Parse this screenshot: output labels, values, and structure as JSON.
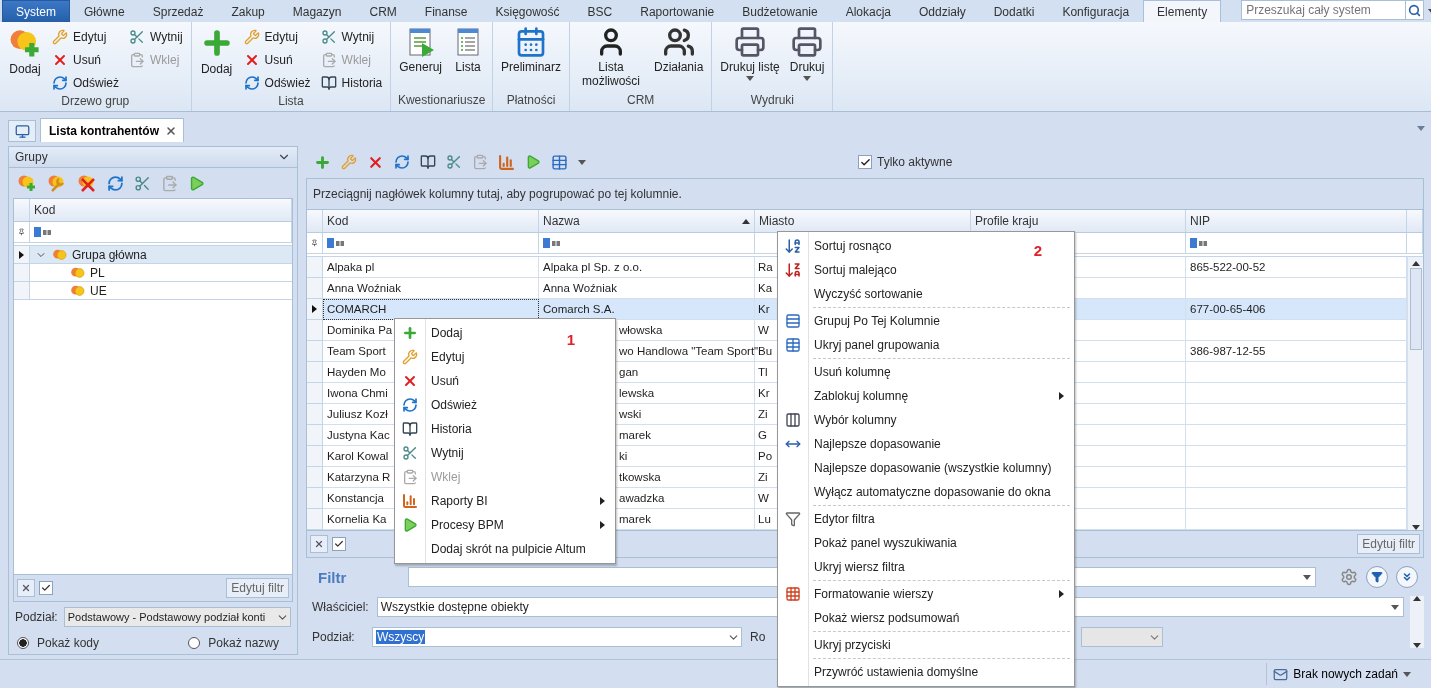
{
  "tabs": [
    {
      "label": "System",
      "selected": false,
      "kind": "application"
    },
    {
      "label": "Główne",
      "selected": false,
      "kind": "ribbon"
    },
    {
      "label": "Sprzedaż",
      "selected": false,
      "kind": "ribbon"
    },
    {
      "label": "Zakup",
      "selected": false,
      "kind": "ribbon"
    },
    {
      "label": "Magazyn",
      "selected": false,
      "kind": "ribbon"
    },
    {
      "label": "CRM",
      "selected": false,
      "kind": "ribbon"
    },
    {
      "label": "Finanse",
      "selected": false,
      "kind": "ribbon"
    },
    {
      "label": "Księgowość",
      "selected": false,
      "kind": "ribbon"
    },
    {
      "label": "BSC",
      "selected": false,
      "kind": "ribbon"
    },
    {
      "label": "Raportowanie",
      "selected": false,
      "kind": "ribbon"
    },
    {
      "label": "Budżetowanie",
      "selected": false,
      "kind": "ribbon"
    },
    {
      "label": "Alokacja",
      "selected": false,
      "kind": "ribbon"
    },
    {
      "label": "Oddziały",
      "selected": false,
      "kind": "ribbon"
    },
    {
      "label": "Dodatki",
      "selected": false,
      "kind": "ribbon"
    },
    {
      "label": "Konfiguracja",
      "selected": false,
      "kind": "ribbon"
    },
    {
      "label": "Elementy",
      "selected": true,
      "kind": "ribbon"
    }
  ],
  "search": {
    "placeholder": "Przeszukaj cały system"
  },
  "ribbon": {
    "groups": [
      {
        "label": "Drzewo grup",
        "buttons": [
          {
            "label": "Dodaj",
            "kind": "large",
            "disabled": false
          },
          {
            "label": "Edytuj",
            "kind": "small",
            "disabled": false
          },
          {
            "label": "Usuń",
            "kind": "small",
            "disabled": false
          },
          {
            "label": "Odśwież",
            "kind": "small",
            "disabled": false
          },
          {
            "label": "Wytnij",
            "kind": "small",
            "disabled": false
          },
          {
            "label": "Wklej",
            "kind": "small",
            "disabled": true
          }
        ]
      },
      {
        "label": "Lista",
        "buttons": [
          {
            "label": "Dodaj",
            "kind": "large",
            "disabled": false
          },
          {
            "label": "Edytuj",
            "kind": "small",
            "disabled": false
          },
          {
            "label": "Usuń",
            "kind": "small",
            "disabled": false
          },
          {
            "label": "Odśwież",
            "kind": "small",
            "disabled": false
          },
          {
            "label": "Wytnij",
            "kind": "small",
            "disabled": false
          },
          {
            "label": "Wklej",
            "kind": "small",
            "disabled": true
          },
          {
            "label": "Historia",
            "kind": "small",
            "disabled": false
          }
        ]
      },
      {
        "label": "Kwestionariusze",
        "buttons": [
          {
            "label": "Generuj",
            "kind": "large",
            "disabled": false
          },
          {
            "label": "Lista",
            "kind": "large",
            "disabled": false
          }
        ]
      },
      {
        "label": "Płatności",
        "buttons": [
          {
            "label": "Preliminarz",
            "kind": "large",
            "disabled": false
          }
        ]
      },
      {
        "label": "CRM",
        "buttons": [
          {
            "label": "Lista możliwości",
            "kind": "large",
            "disabled": false
          },
          {
            "label": "Działania",
            "kind": "large",
            "disabled": false
          }
        ]
      },
      {
        "label": "Wydruki",
        "buttons": [
          {
            "label": "Drukuj listę",
            "kind": "split",
            "disabled": false
          },
          {
            "label": "Drukuj",
            "kind": "split",
            "disabled": false
          }
        ]
      }
    ]
  },
  "doc_tabs": [
    {
      "label": "Lista kontrahentów",
      "selected": true
    }
  ],
  "left_panel": {
    "title": "Grupy",
    "column": "Kod",
    "tree": [
      {
        "label": "Grupa główna",
        "selected": true,
        "expanded": true,
        "children": [
          {
            "label": "PL",
            "selected": false
          },
          {
            "label": "UE",
            "selected": false
          }
        ]
      }
    ],
    "filter_enabled": true,
    "edit_filter": "Edytuj filtr",
    "division": {
      "label": "Podział:",
      "value": "Podstawowy - Podstawowy podział konti"
    },
    "display": [
      {
        "label": "Pokaż kody",
        "selected": true
      },
      {
        "label": "Pokaż nazwy",
        "selected": false
      }
    ]
  },
  "right_panel": {
    "only_active": {
      "label": "Tylko aktywne",
      "checked": true
    },
    "group_hint": "Przeciągnij nagłówek kolumny tutaj, aby pogrupować po tej kolumnie.",
    "columns": [
      {
        "label": "Kod",
        "sorted": false
      },
      {
        "label": "Nazwa",
        "sorted": true
      },
      {
        "label": "Miasto",
        "sorted": false
      },
      {
        "label": "Profile kraju",
        "sorted": false
      },
      {
        "label": "NIP",
        "sorted": false
      }
    ],
    "rows": [
      {
        "kod": "Alpaka pl",
        "nazwa": "Alpaka pl Sp. z o.o.",
        "miasto": "Ra",
        "nip": "865-522-00-52",
        "selected": false,
        "kind": "plain"
      },
      {
        "kod": "Anna Woźniak",
        "nazwa": "Anna Woźniak",
        "miasto": "Ka",
        "selected": false,
        "kind": "plain"
      },
      {
        "kod": "COMARCH",
        "nazwa": "Comarch S.A.",
        "miasto": "Kr",
        "nip": "677-00-65-406",
        "selected": true,
        "kind": "plain"
      },
      {
        "kod": "Dominika Pa",
        "nazwa": "włowska",
        "miasto": "W",
        "selected": false,
        "kind": "covered"
      },
      {
        "kod": "Team Sport",
        "nazwa": "wo Handlowa \"Team Sport\"",
        "miasto": "Bu",
        "nip": "386-987-12-55",
        "selected": false,
        "kind": "covered"
      },
      {
        "kod": "Hayden Mo",
        "nazwa": "gan",
        "miasto": "Tl",
        "selected": false,
        "kind": "covered"
      },
      {
        "kod": "Iwona Chmi",
        "nazwa": "lewska",
        "miasto": "Kr",
        "selected": false,
        "kind": "covered"
      },
      {
        "kod": "Juliusz Kozł",
        "nazwa": "wski",
        "miasto": "Zi",
        "selected": false,
        "kind": "covered"
      },
      {
        "kod": "Justyna Kac",
        "nazwa": "marek",
        "miasto": "G",
        "selected": false,
        "kind": "covered"
      },
      {
        "kod": "Karol Kowal",
        "nazwa": "ki",
        "miasto": "Po",
        "selected": false,
        "kind": "covered"
      },
      {
        "kod": "Katarzyna R",
        "nazwa": "tkowska",
        "miasto": "Zi",
        "selected": false,
        "kind": "covered"
      },
      {
        "kod": "Konstancja",
        "nazwa": "awadzka",
        "miasto": "W",
        "selected": false,
        "kind": "covered"
      },
      {
        "kod": "Kornelia Ka",
        "nazwa": "marek",
        "miasto": "Lu",
        "selected": false,
        "kind": "covered"
      }
    ],
    "filter_enabled": true,
    "edit_filter": "Edytuj filtr",
    "filter": {
      "label": "Filtr"
    },
    "owner": {
      "label": "Właściciel:",
      "value": "Wszystkie dostępne obiekty"
    },
    "division": {
      "label": "Podział:",
      "value": "Wszyscy"
    },
    "column_3_label": "Ro"
  },
  "context_menus": [
    {
      "badge": "1",
      "groups": [
        [
          {
            "label": "Dodaj",
            "disabled": false,
            "submenu": false
          },
          {
            "label": "Edytuj",
            "disabled": false,
            "submenu": false
          },
          {
            "label": "Usuń",
            "disabled": false,
            "submenu": false
          },
          {
            "label": "Odśwież",
            "disabled": false,
            "submenu": false
          },
          {
            "label": "Historia",
            "disabled": false,
            "submenu": false
          },
          {
            "label": "Wytnij",
            "disabled": false,
            "submenu": false
          },
          {
            "label": "Wklej",
            "disabled": true,
            "submenu": false
          },
          {
            "label": "Raporty BI",
            "disabled": false,
            "submenu": true
          },
          {
            "label": "Procesy BPM",
            "disabled": false,
            "submenu": true
          },
          {
            "label": "Dodaj skrót na pulpicie Altum",
            "disabled": false,
            "submenu": false
          }
        ]
      ]
    },
    {
      "badge": "2",
      "groups": [
        [
          {
            "label": "Sortuj rosnąco",
            "disabled": false,
            "submenu": false
          },
          {
            "label": "Sortuj malejąco",
            "disabled": false,
            "submenu": false
          },
          {
            "label": "Wyczyść sortowanie",
            "disabled": false,
            "submenu": false
          }
        ],
        [
          {
            "label": "Grupuj Po Tej Kolumnie",
            "disabled": false,
            "submenu": false
          },
          {
            "label": "Ukryj panel grupowania",
            "disabled": false,
            "submenu": false
          }
        ],
        [
          {
            "label": "Usuń kolumnę",
            "disabled": false,
            "submenu": false
          },
          {
            "label": "Zablokuj kolumnę",
            "disabled": false,
            "submenu": true
          },
          {
            "label": "Wybór kolumny",
            "disabled": false,
            "submenu": false
          },
          {
            "label": "Najlepsze dopasowanie",
            "disabled": false,
            "submenu": false
          },
          {
            "label": "Najlepsze dopasowanie (wszystkie kolumny)",
            "disabled": false,
            "submenu": false
          },
          {
            "label": "Wyłącz automatyczne dopasowanie do okna",
            "disabled": false,
            "submenu": false
          }
        ],
        [
          {
            "label": "Edytor filtra",
            "disabled": false,
            "submenu": false
          },
          {
            "label": "Pokaż panel wyszukiwania",
            "disabled": false,
            "submenu": false
          },
          {
            "label": "Ukryj wiersz filtra",
            "disabled": false,
            "submenu": false
          }
        ],
        [
          {
            "label": "Formatowanie wierszy",
            "disabled": false,
            "submenu": true
          },
          {
            "label": "Pokaż wiersz podsumowań",
            "disabled": false,
            "submenu": false
          }
        ],
        [
          {
            "label": "Ukryj przyciski",
            "disabled": false,
            "submenu": false
          }
        ],
        [
          {
            "label": "Przywróć ustawienia domyślne",
            "disabled": false,
            "submenu": false
          }
        ]
      ]
    }
  ],
  "status_bar": {
    "tasks": "Brak nowych zadań"
  }
}
